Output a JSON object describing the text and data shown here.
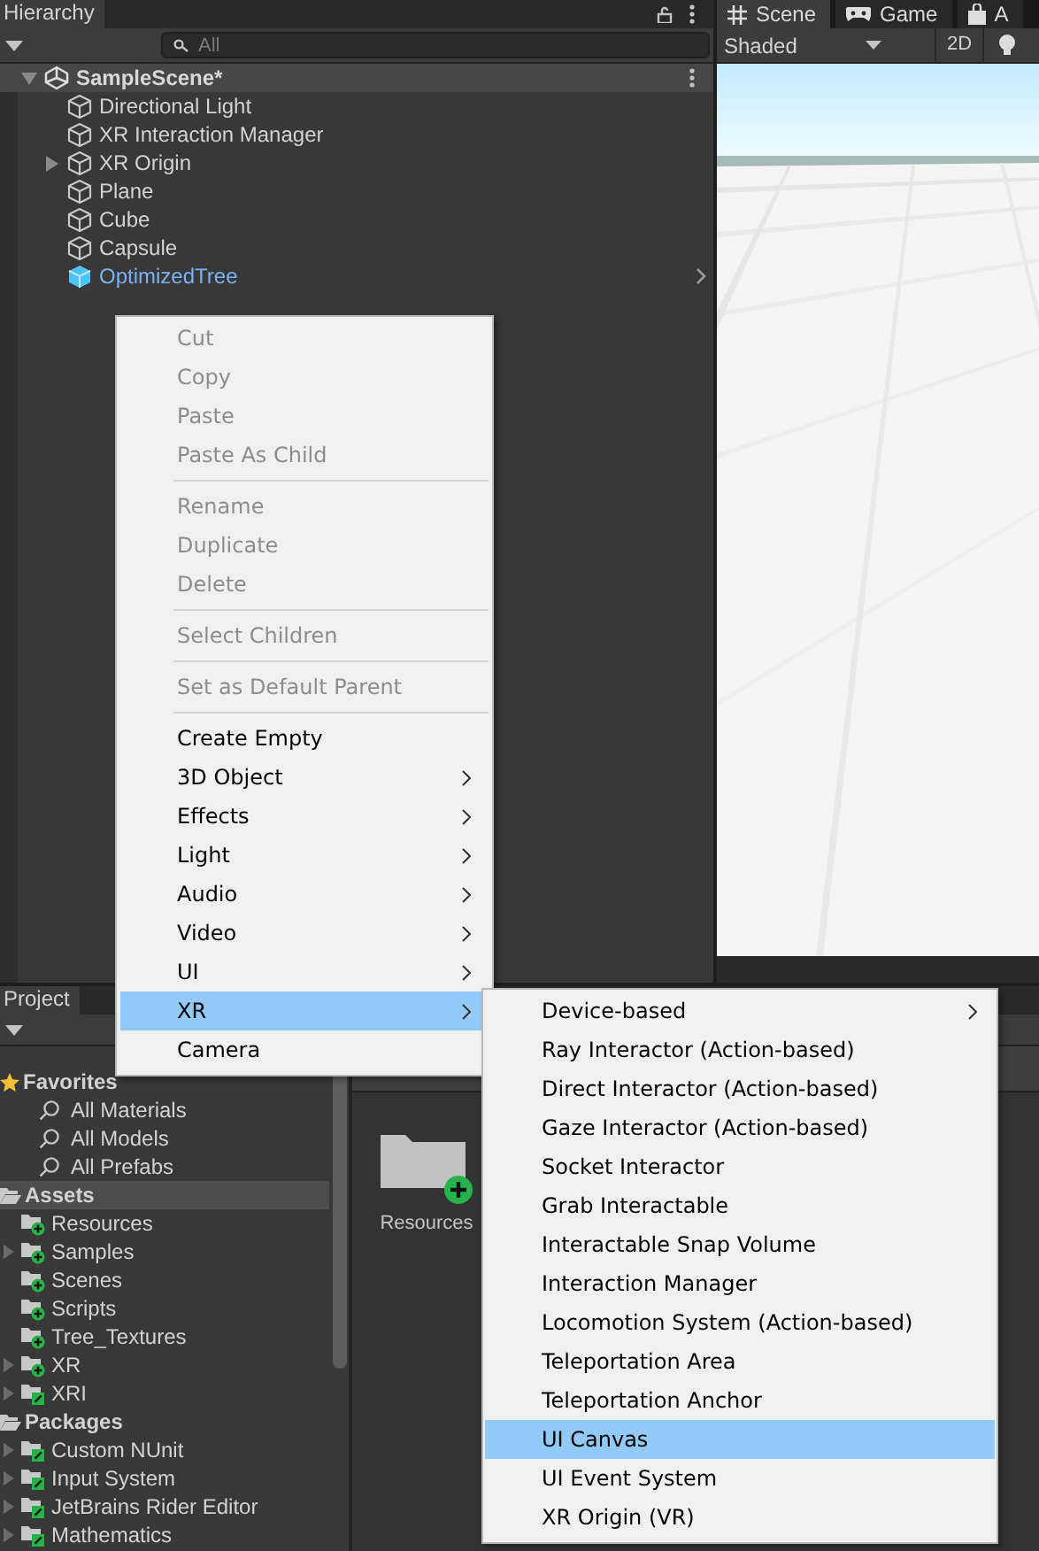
{
  "hierarchy": {
    "tab": "Hierarchy",
    "search": {
      "placeholder": "All"
    },
    "scene": {
      "name": "SampleScene*",
      "expanded": true
    },
    "objects": [
      {
        "name": "Directional Light",
        "kind": "gameobject",
        "expandable": false
      },
      {
        "name": "XR Interaction Manager",
        "kind": "gameobject",
        "expandable": false
      },
      {
        "name": "XR Origin",
        "kind": "gameobject",
        "expandable": true
      },
      {
        "name": "Plane",
        "kind": "gameobject",
        "expandable": false
      },
      {
        "name": "Cube",
        "kind": "gameobject",
        "expandable": false
      },
      {
        "name": "Capsule",
        "kind": "gameobject",
        "expandable": false
      },
      {
        "name": "OptimizedTree",
        "kind": "prefab",
        "expandable": false
      }
    ]
  },
  "scene_view": {
    "tabs": [
      {
        "label": "Scene",
        "selected": true
      },
      {
        "label": "Game",
        "selected": false
      },
      {
        "label": "A",
        "selected": false
      }
    ],
    "shading": "Shaded",
    "mode_2d": "2D"
  },
  "project": {
    "tab": "Project",
    "tree": [
      {
        "label": "Favorites",
        "kind": "favorites",
        "selected": false,
        "children": [
          {
            "label": "All Materials",
            "kind": "search",
            "selected": false
          },
          {
            "label": "All Models",
            "kind": "search",
            "selected": false
          },
          {
            "label": "All Prefabs",
            "kind": "search",
            "selected": false
          }
        ]
      },
      {
        "label": "Assets",
        "kind": "root",
        "selected": true,
        "children": [
          {
            "label": "Resources",
            "kind": "folder",
            "added": true,
            "expandable": false,
            "selected": false
          },
          {
            "label": "Samples",
            "kind": "folder",
            "added": true,
            "expandable": true,
            "selected": false
          },
          {
            "label": "Scenes",
            "kind": "folder",
            "added": true,
            "expandable": false,
            "selected": false
          },
          {
            "label": "Scripts",
            "kind": "folder",
            "added": true,
            "expandable": false,
            "selected": false
          },
          {
            "label": "Tree_Textures",
            "kind": "folder",
            "added": true,
            "expandable": false,
            "selected": false
          },
          {
            "label": "XR",
            "kind": "folder",
            "added": true,
            "expandable": true,
            "selected": false
          },
          {
            "label": "XRI",
            "kind": "folder",
            "added": false,
            "expandable": true,
            "selected": false
          }
        ]
      },
      {
        "label": "Packages",
        "kind": "root",
        "selected": false,
        "children": [
          {
            "label": "Custom NUnit",
            "kind": "folder",
            "added": false,
            "expandable": true,
            "selected": false
          },
          {
            "label": "Input System",
            "kind": "folder",
            "added": false,
            "expandable": true,
            "selected": false
          },
          {
            "label": "JetBrains Rider Editor",
            "kind": "folder",
            "added": false,
            "expandable": true,
            "selected": false
          },
          {
            "label": "Mathematics",
            "kind": "folder",
            "added": false,
            "expandable": true,
            "selected": false
          }
        ]
      }
    ],
    "assets": [
      {
        "label": "Resources",
        "added": true
      }
    ]
  },
  "context_menu": {
    "items": [
      {
        "kind": "item",
        "label": "Cut",
        "disabled": true,
        "submenu": false,
        "selected": false
      },
      {
        "kind": "item",
        "label": "Copy",
        "disabled": true,
        "submenu": false,
        "selected": false
      },
      {
        "kind": "item",
        "label": "Paste",
        "disabled": true,
        "submenu": false,
        "selected": false
      },
      {
        "kind": "item",
        "label": "Paste As Child",
        "disabled": true,
        "submenu": false,
        "selected": false
      },
      {
        "kind": "separator"
      },
      {
        "kind": "item",
        "label": "Rename",
        "disabled": true,
        "submenu": false,
        "selected": false
      },
      {
        "kind": "item",
        "label": "Duplicate",
        "disabled": true,
        "submenu": false,
        "selected": false
      },
      {
        "kind": "item",
        "label": "Delete",
        "disabled": true,
        "submenu": false,
        "selected": false
      },
      {
        "kind": "separator"
      },
      {
        "kind": "item",
        "label": "Select Children",
        "disabled": true,
        "submenu": false,
        "selected": false
      },
      {
        "kind": "separator"
      },
      {
        "kind": "item",
        "label": "Set as Default Parent",
        "disabled": true,
        "submenu": false,
        "selected": false
      },
      {
        "kind": "separator"
      },
      {
        "kind": "item",
        "label": "Create Empty",
        "disabled": false,
        "submenu": false,
        "selected": false
      },
      {
        "kind": "item",
        "label": "3D Object",
        "disabled": false,
        "submenu": true,
        "selected": false
      },
      {
        "kind": "item",
        "label": "Effects",
        "disabled": false,
        "submenu": true,
        "selected": false
      },
      {
        "kind": "item",
        "label": "Light",
        "disabled": false,
        "submenu": true,
        "selected": false
      },
      {
        "kind": "item",
        "label": "Audio",
        "disabled": false,
        "submenu": true,
        "selected": false
      },
      {
        "kind": "item",
        "label": "Video",
        "disabled": false,
        "submenu": true,
        "selected": false
      },
      {
        "kind": "item",
        "label": "UI",
        "disabled": false,
        "submenu": true,
        "selected": false
      },
      {
        "kind": "item",
        "label": "XR",
        "disabled": false,
        "submenu": true,
        "selected": true
      },
      {
        "kind": "item",
        "label": "Camera",
        "disabled": false,
        "submenu": false,
        "selected": false
      }
    ]
  },
  "submenu": {
    "items": [
      {
        "kind": "item",
        "label": "Device-based",
        "disabled": false,
        "submenu": true,
        "selected": false
      },
      {
        "kind": "item",
        "label": "Ray Interactor (Action-based)",
        "disabled": false,
        "submenu": false,
        "selected": false
      },
      {
        "kind": "item",
        "label": "Direct Interactor (Action-based)",
        "disabled": false,
        "submenu": false,
        "selected": false
      },
      {
        "kind": "item",
        "label": "Gaze Interactor (Action-based)",
        "disabled": false,
        "submenu": false,
        "selected": false
      },
      {
        "kind": "item",
        "label": "Socket Interactor",
        "disabled": false,
        "submenu": false,
        "selected": false
      },
      {
        "kind": "item",
        "label": "Grab Interactable",
        "disabled": false,
        "submenu": false,
        "selected": false
      },
      {
        "kind": "item",
        "label": "Interactable Snap Volume",
        "disabled": false,
        "submenu": false,
        "selected": false
      },
      {
        "kind": "item",
        "label": "Interaction Manager",
        "disabled": false,
        "submenu": false,
        "selected": false
      },
      {
        "kind": "item",
        "label": "Locomotion System (Action-based)",
        "disabled": false,
        "submenu": false,
        "selected": false
      },
      {
        "kind": "item",
        "label": "Teleportation Area",
        "disabled": false,
        "submenu": false,
        "selected": false
      },
      {
        "kind": "item",
        "label": "Teleportation Anchor",
        "disabled": false,
        "submenu": false,
        "selected": false
      },
      {
        "kind": "item",
        "label": "UI Canvas",
        "disabled": false,
        "submenu": false,
        "selected": true
      },
      {
        "kind": "item",
        "label": "UI Event System",
        "disabled": false,
        "submenu": false,
        "selected": false
      },
      {
        "kind": "item",
        "label": "XR Origin (VR)",
        "disabled": false,
        "submenu": false,
        "selected": false
      }
    ]
  }
}
